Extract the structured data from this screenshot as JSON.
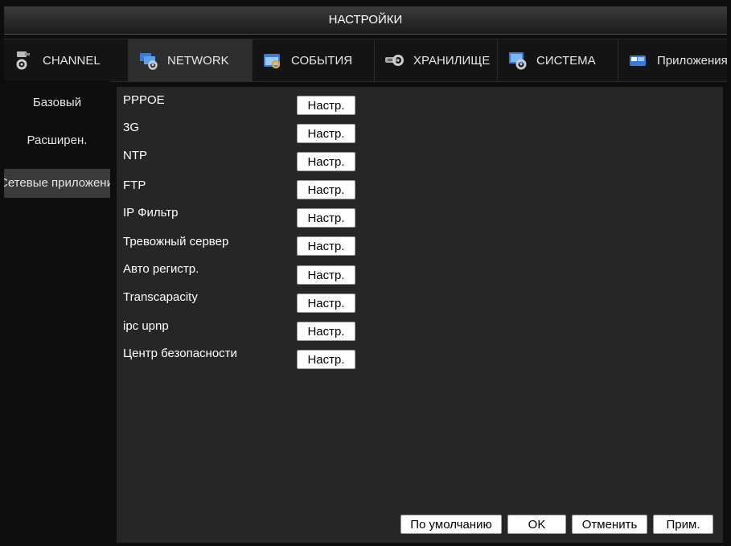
{
  "window": {
    "title": "НАСТРОЙКИ"
  },
  "tabs": [
    {
      "label": "CHANNEL",
      "icon": "camera-gear-icon"
    },
    {
      "label": "NETWORK",
      "icon": "network-gear-icon"
    },
    {
      "label": "СОБЫТИЯ",
      "icon": "events-icon"
    },
    {
      "label": "ХРАНИЛИЩЕ",
      "icon": "storage-icon"
    },
    {
      "label": "СИСТЕМА",
      "icon": "system-gear-icon"
    },
    {
      "label": "Приложения",
      "icon": "apps-icon"
    }
  ],
  "active_tab": "NETWORK",
  "sidebar": {
    "items": [
      {
        "label": "Базовый"
      },
      {
        "label": "Расширен."
      },
      {
        "label": "Сетевые приложения"
      }
    ],
    "active_index": 2
  },
  "settings": {
    "button_label": "Настр.",
    "rows": [
      {
        "label": "PPPOE"
      },
      {
        "label": "3G"
      },
      {
        "label": "NTP"
      },
      {
        "label": "FTP"
      },
      {
        "label": "IP Фильтр"
      },
      {
        "label": "Тревожный сервер"
      },
      {
        "label": "Авто регистр."
      },
      {
        "label": "Transcapacity"
      },
      {
        "label": "ipc upnp"
      },
      {
        "label": "Центр безопасности"
      }
    ]
  },
  "footer": {
    "default_label": "По умолчанию",
    "ok_label": "OK",
    "cancel_label": "Отменить",
    "apply_label": "Прим."
  },
  "colors": {
    "background": "#0d0d0d",
    "panel": "#262626",
    "active_tab": "#2e2e2e",
    "active_sidebar": "#3a3a3a",
    "button": "#ffffff",
    "text": "#ffffff"
  }
}
